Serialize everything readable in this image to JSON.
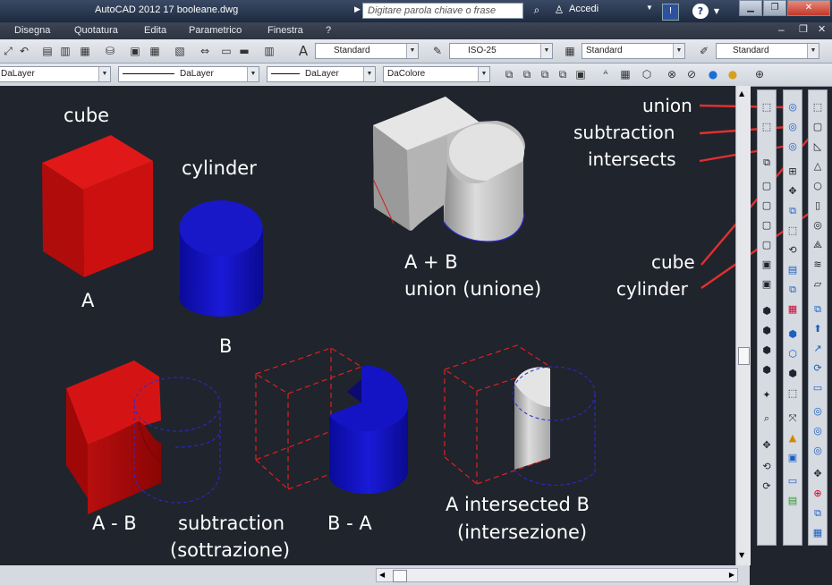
{
  "titlebar": {
    "title": "AutoCAD 2012   17 booleane.dwg",
    "search_placeholder": "Digitare parola chiave o frase",
    "signin": "Accedi",
    "help": "?"
  },
  "menu": [
    "Disegna",
    "Quotatura",
    "Edita",
    "Parametrico",
    "Finestra",
    "?"
  ],
  "styles_toolbar": {
    "text_style": "Standard",
    "dim_style": "ISO-25",
    "table_style": "Standard",
    "mleader_style": "Standard"
  },
  "properties_toolbar": {
    "layer": "DaLayer",
    "linetype": "DaLayer",
    "lineweight": "DaLayer",
    "color": "DaColore"
  },
  "annotations": {
    "cube": "cube",
    "cylinder": "cylinder",
    "a": "A",
    "b": "B",
    "union_line1": "A + B",
    "union_line2": "union  (unione)",
    "a_minus_b": "A - B",
    "subtraction": "subtraction",
    "sottrazione": "(sottrazione)",
    "b_minus_a": "B - A",
    "intersect_line1": "A intersected B",
    "intersect_line2": "(intersezione)",
    "callout_union": "union",
    "callout_subtraction": "subtraction",
    "callout_intersects": "intersects",
    "callout_cube": "cube",
    "callout_cylinder": "cylinder"
  },
  "colors": {
    "canvas": "#20242d",
    "cube_red": "#c41010",
    "cylinder_blue": "#1010b8",
    "union_grey": "#c8c8c8",
    "callout_line": "#e03030"
  }
}
